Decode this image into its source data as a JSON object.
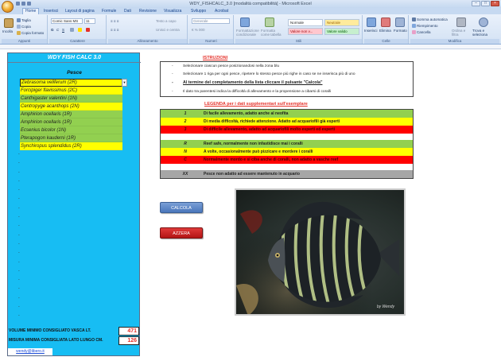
{
  "window": {
    "title": "WDY_FISHCALC_3.0  [modalità compatibilità] - Microsoft Excel"
  },
  "ribbon": {
    "tabs": [
      "Home",
      "Inserisci",
      "Layout di pagina",
      "Formule",
      "Dati",
      "Revisione",
      "Visualizza",
      "Sviluppo",
      "Acrobat"
    ],
    "clipboard": {
      "paste": "Incolla",
      "cut": "Taglia",
      "copy": "Copia",
      "format_painter": "Copia formato",
      "label": "Appunti"
    },
    "font": {
      "name": "Comic Sans MS",
      "size": "11",
      "label": "Carattere"
    },
    "alignment": {
      "wrap": "Testo a capo",
      "merge": "Unisci e centra",
      "label": "Allineamento"
    },
    "number": {
      "format": "Generale",
      "label": "Numeri"
    },
    "styles": {
      "conditional": "Formattazione condizionale",
      "table": "Formatta come tabella",
      "normal": "Normale",
      "neutral": "Neutrale",
      "bad": "Valore non v...",
      "good": "Valore valido",
      "label": "Stili"
    },
    "cells": {
      "insert": "Inserisci",
      "delete": "Elimina",
      "format": "Formato",
      "label": "Celle"
    },
    "editing": {
      "autosum": "Somma automatica",
      "fill": "Riempimento",
      "clear": "Cancella",
      "sort": "Ordina e filtra",
      "find": "Trova e seleziona",
      "label": "Modifica"
    }
  },
  "panel": {
    "title": "WDY FISH CALC 3.0",
    "header": "Pesce",
    "selected": "Zebrasoma veliferum  (2R)",
    "fish": [
      {
        "name": "Forcipiger flavissimus (2C)",
        "color": "y"
      },
      {
        "name": "Canthigaster valentini (1N)",
        "color": "g"
      },
      {
        "name": "Centropyge acanthops (2N)",
        "color": "y"
      },
      {
        "name": "Amphirion ocellaris (1R)",
        "color": "g"
      },
      {
        "name": "Amphirion ocellaris (1R)",
        "color": "g"
      },
      {
        "name": "Ecsenius bicolor (1N)",
        "color": "g"
      },
      {
        "name": "Pterapogon kauderni  (1R)",
        "color": "g"
      },
      {
        "name": "Synchiropus splendidus (2R)",
        "color": "y"
      }
    ],
    "dash": "-",
    "volume_label": "VOLUME MINIMO CONSIGLIATO VASCA LT.",
    "volume_value": "471",
    "length_label": "MISURA MINIMA CONSIGLIATA LATO LUNGO CM.",
    "length_value": "126",
    "email": "wendy@libero.it"
  },
  "istruzioni": {
    "title": "ISTRUZIONI",
    "bullet": "-",
    "rows": [
      "Selezionare ciascun pesce posizionandosi nella zona blu",
      "Selezionare 1 riga per ogni pesce, ripetere lo stesso pesce più righe in caso se ne inserisca più di uno",
      "Al termine del completamento della lista cliccare il pulsante \"Calcola\"",
      "Il dato tra parentesi indica la difficoltà di allevamento e la propensione a cibarsi di coralli"
    ]
  },
  "legenda": {
    "title": "LEGENDA per i dati supplementari sull'esemplare",
    "rows": [
      {
        "code": "1",
        "text": "Di facile allevamento, adatto anche al neofita",
        "color": "g"
      },
      {
        "code": "2",
        "text": "Di media difficoltà, richiede attenzione. Adatto ad acquariofili già esperti",
        "color": "y"
      },
      {
        "code": "3",
        "text": "Di difficile allevamento, adatto ad acquariofili molto esperti ed esperti",
        "color": "r"
      },
      {
        "code": "",
        "text": "",
        "color": "w"
      },
      {
        "code": "R",
        "text": "Reef safe, normalmente non infastidisce mai i coralli",
        "color": "g"
      },
      {
        "code": "N",
        "text": "A volte, occasionalmente può pizzicare e mordere i coralli",
        "color": "y"
      },
      {
        "code": "C",
        "text": "Normalmente mordo e si ciba anche di coralli, non adatto a vasche reef",
        "color": "r"
      },
      {
        "code": "",
        "text": "",
        "color": "w"
      },
      {
        "code": "XX",
        "text": "Pesce non adatto ad essere mantenuto in acquario",
        "color": "gr"
      }
    ]
  },
  "buttons": {
    "calcola": "CALCOLA",
    "azzera": "AZZERA"
  },
  "photo": {
    "watermark": "by Wendy"
  },
  "colors": {
    "panel_blue": "#17bdf3",
    "yellow": "#ffff00",
    "green": "#92d050",
    "red": "#ff0000",
    "gray": "#a6a6a6"
  }
}
